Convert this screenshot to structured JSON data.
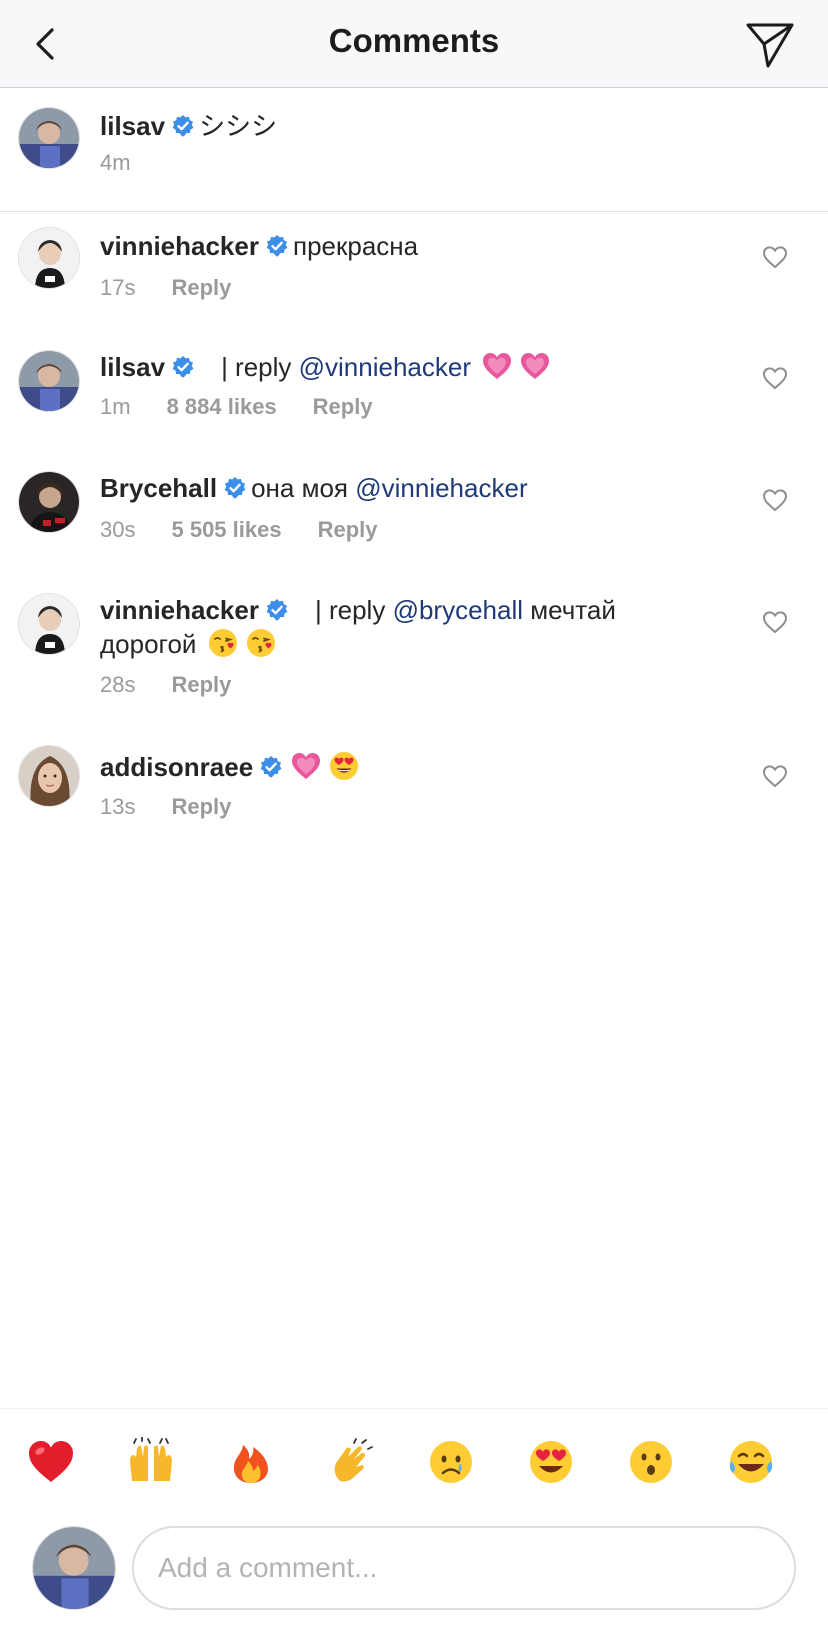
{
  "header": {
    "title": "Comments"
  },
  "caption": {
    "username": "lilsav",
    "text": "シシシ",
    "time": "4m"
  },
  "comments": [
    {
      "username": "vinniehacker",
      "text": "прекрасна",
      "time": "17s",
      "reply": "Reply"
    },
    {
      "username": "lilsav",
      "reply_prefix": "| reply",
      "mention": "@vinniehacker",
      "time": "1m",
      "likes": "8 884 likes",
      "reply": "Reply"
    },
    {
      "username": "Brycehall",
      "text": "она моя",
      "mention": "@vinniehacker",
      "time": "30s",
      "likes": "5 505 likes",
      "reply": "Reply"
    },
    {
      "username": "vinniehacker",
      "reply_prefix": "| reply",
      "mention": "@brycehall",
      "text": "мечтай",
      "text2": "дорогой",
      "time": "28s",
      "reply": "Reply"
    },
    {
      "username": "addisonraee",
      "time": "13s",
      "reply": "Reply"
    }
  ],
  "emoji_bar": [
    "heart-emoji",
    "raised-hands-emoji",
    "fire-emoji",
    "clapping-emoji",
    "crying-emoji",
    "heart-eyes-emoji",
    "surprised-emoji",
    "laughing-emoji"
  ],
  "input": {
    "placeholder": "Add a comment..."
  },
  "colors": {
    "mention": "#1e3a78",
    "verified": "#3d8ee8",
    "meta": "#9a9a9a"
  }
}
